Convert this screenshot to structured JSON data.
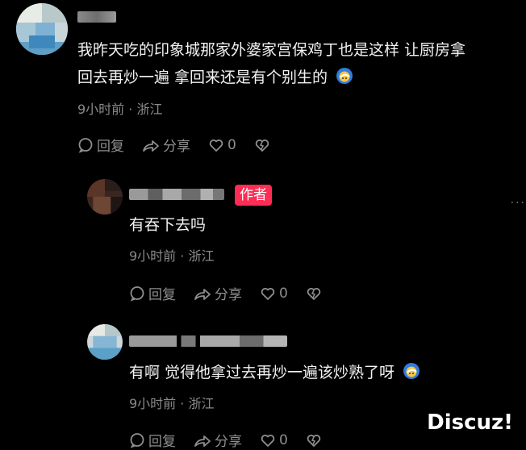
{
  "comments": [
    {
      "text_line1": "我昨天吃的印象城那家外婆家宫保鸡丁也是这样 让厨房拿",
      "text_line2": "回去再炒一遍 拿回来还是有个别生的",
      "meta": "9小时前 · 浙江",
      "reply_label": "回复",
      "share_label": "分享",
      "like_count": "0"
    },
    {
      "author_badge": "作者",
      "text": "有吞下去吗",
      "meta": "9小时前 · 浙江",
      "reply_label": "回复",
      "share_label": "分享",
      "like_count": "0"
    },
    {
      "text": "有啊 觉得他拿过去再炒一遍该炒熟了呀",
      "meta": "9小时前 · 浙江",
      "reply_label": "回复",
      "share_label": "分享",
      "like_count": "0"
    }
  ],
  "more_dots": "···",
  "watermark": "Discuz!",
  "colors": {
    "author_badge": "#ff2d55",
    "meta_text": "#8a8a8a",
    "background": "#000000"
  },
  "icons": [
    "reply-icon",
    "share-icon",
    "heart-icon",
    "dislike-icon",
    "facepalm-emoji"
  ]
}
